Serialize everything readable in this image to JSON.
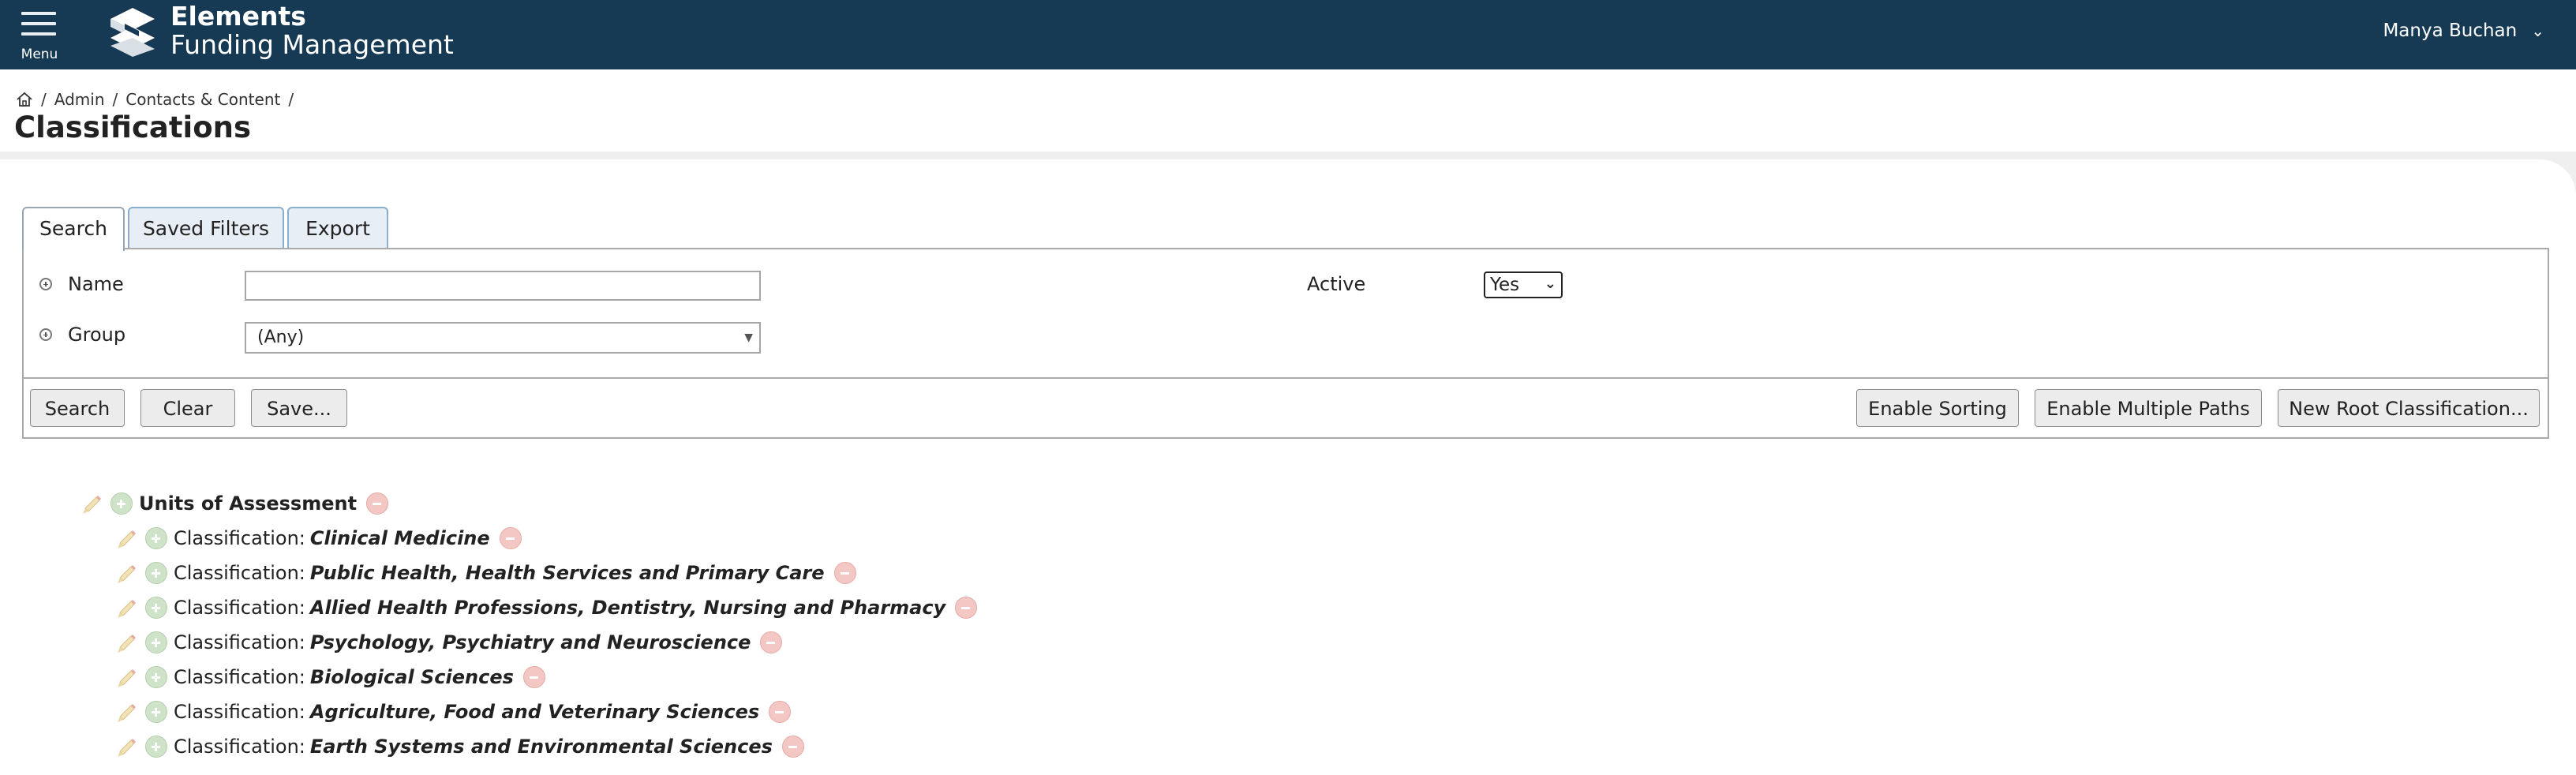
{
  "app": {
    "menu_label": "Menu",
    "title": "Elements",
    "subtitle": "Funding Management",
    "user_name": "Manya Buchan"
  },
  "breadcrumb": {
    "items": [
      "Admin",
      "Contacts & Content"
    ],
    "separator": "/"
  },
  "page": {
    "title": "Classifications"
  },
  "tabs": [
    {
      "label": "Search",
      "active": true
    },
    {
      "label": "Saved Filters",
      "active": false
    },
    {
      "label": "Export",
      "active": false
    }
  ],
  "filters": {
    "name": {
      "label": "Name",
      "value": ""
    },
    "group": {
      "label": "Group",
      "value": "(Any)"
    },
    "active": {
      "label": "Active",
      "value": "Yes"
    }
  },
  "buttons": {
    "search": "Search",
    "clear": "Clear",
    "save": "Save...",
    "enable_sorting": "Enable Sorting",
    "enable_multiple_paths": "Enable Multiple Paths",
    "new_root": "New Root Classification..."
  },
  "tree": {
    "root": {
      "label": "Units of Assessment"
    },
    "prefix": "Classification:",
    "children": [
      "Clinical Medicine",
      "Public Health, Health Services and Primary Care",
      "Allied Health Professions, Dentistry, Nursing and Pharmacy",
      "Psychology, Psychiatry and Neuroscience",
      "Biological Sciences",
      "Agriculture, Food and Veterinary Sciences",
      "Earth Systems and Environmental Sciences"
    ]
  },
  "colors": {
    "topbar": "#163a54",
    "tab_active_border": "#9aa7b3",
    "tab_inactive_bg": "#e8eef5",
    "add_green": "#cfe3c9",
    "remove_red": "#f3c8c4"
  },
  "icons": [
    "menu-icon",
    "elements-logo",
    "chevron-down-icon",
    "home-icon",
    "expand-filter-icon",
    "pencil-icon",
    "add-icon",
    "remove-icon"
  ]
}
